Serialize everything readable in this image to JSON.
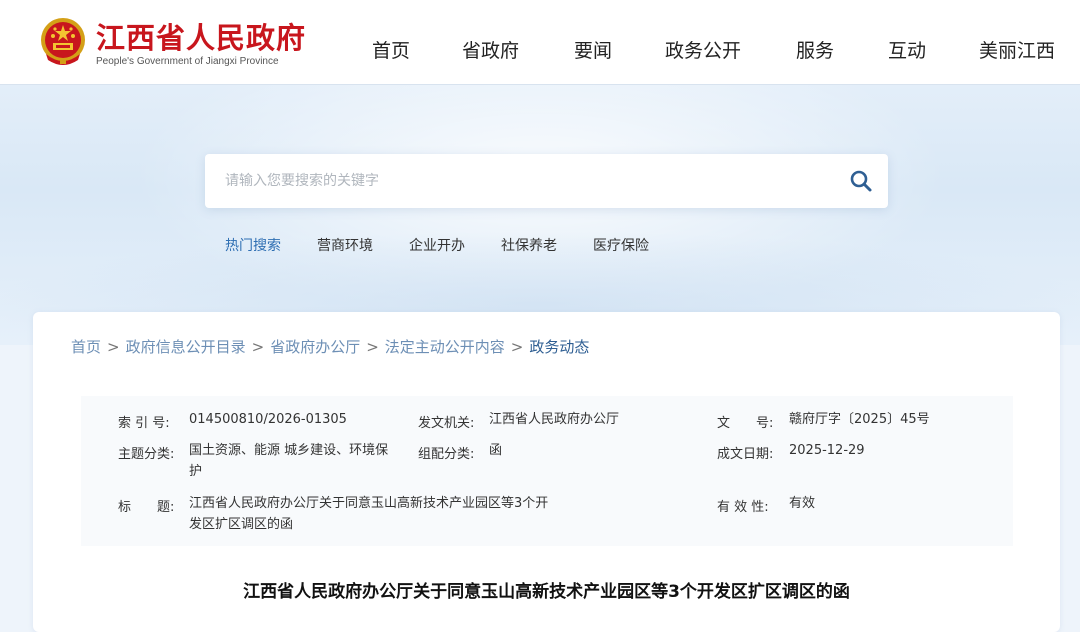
{
  "header": {
    "logo_cn": "江西省人民政府",
    "logo_en": "People's Government of Jiangxi Province",
    "nav": [
      "首页",
      "省政府",
      "要闻",
      "政务公开",
      "服务",
      "互动",
      "美丽江西"
    ]
  },
  "search": {
    "placeholder": "请输入您要搜索的关键字",
    "hot_label": "热门搜索",
    "hot_items": [
      "营商环境",
      "企业开办",
      "社保养老",
      "医疗保险"
    ]
  },
  "breadcrumb": [
    "首页",
    "政府信息公开目录",
    "省政府办公厅",
    "法定主动公开内容",
    "政务动态"
  ],
  "breadcrumb_sep": ">",
  "meta": {
    "index_label": "索 引 号:",
    "index_value": "014500810/2026-01305",
    "issuer_label": "发文机关:",
    "issuer_value": "江西省人民政府办公厅",
    "docno_label": "文　　号:",
    "docno_value": "赣府厅字〔2025〕45号",
    "topic_label": "主题分类:",
    "topic_value": "国土资源、能源 城乡建设、环境保护",
    "group_label": "组配分类:",
    "group_value": "函",
    "date_label": "成文日期:",
    "date_value": "2025-12-29",
    "title_label": "标　　题:",
    "title_value": "江西省人民政府办公厅关于同意玉山高新技术产业园区等3个开发区扩区调区的函",
    "valid_label": "有 效 性:",
    "valid_value": "有效"
  },
  "doc_title": "江西省人民政府办公厅关于同意玉山高新技术产业园区等3个开发区扩区调区的函",
  "colors": {
    "brand_red": "#c8161d",
    "link_blue": "#6d8fb5",
    "accent_blue": "#2f6fb3"
  }
}
